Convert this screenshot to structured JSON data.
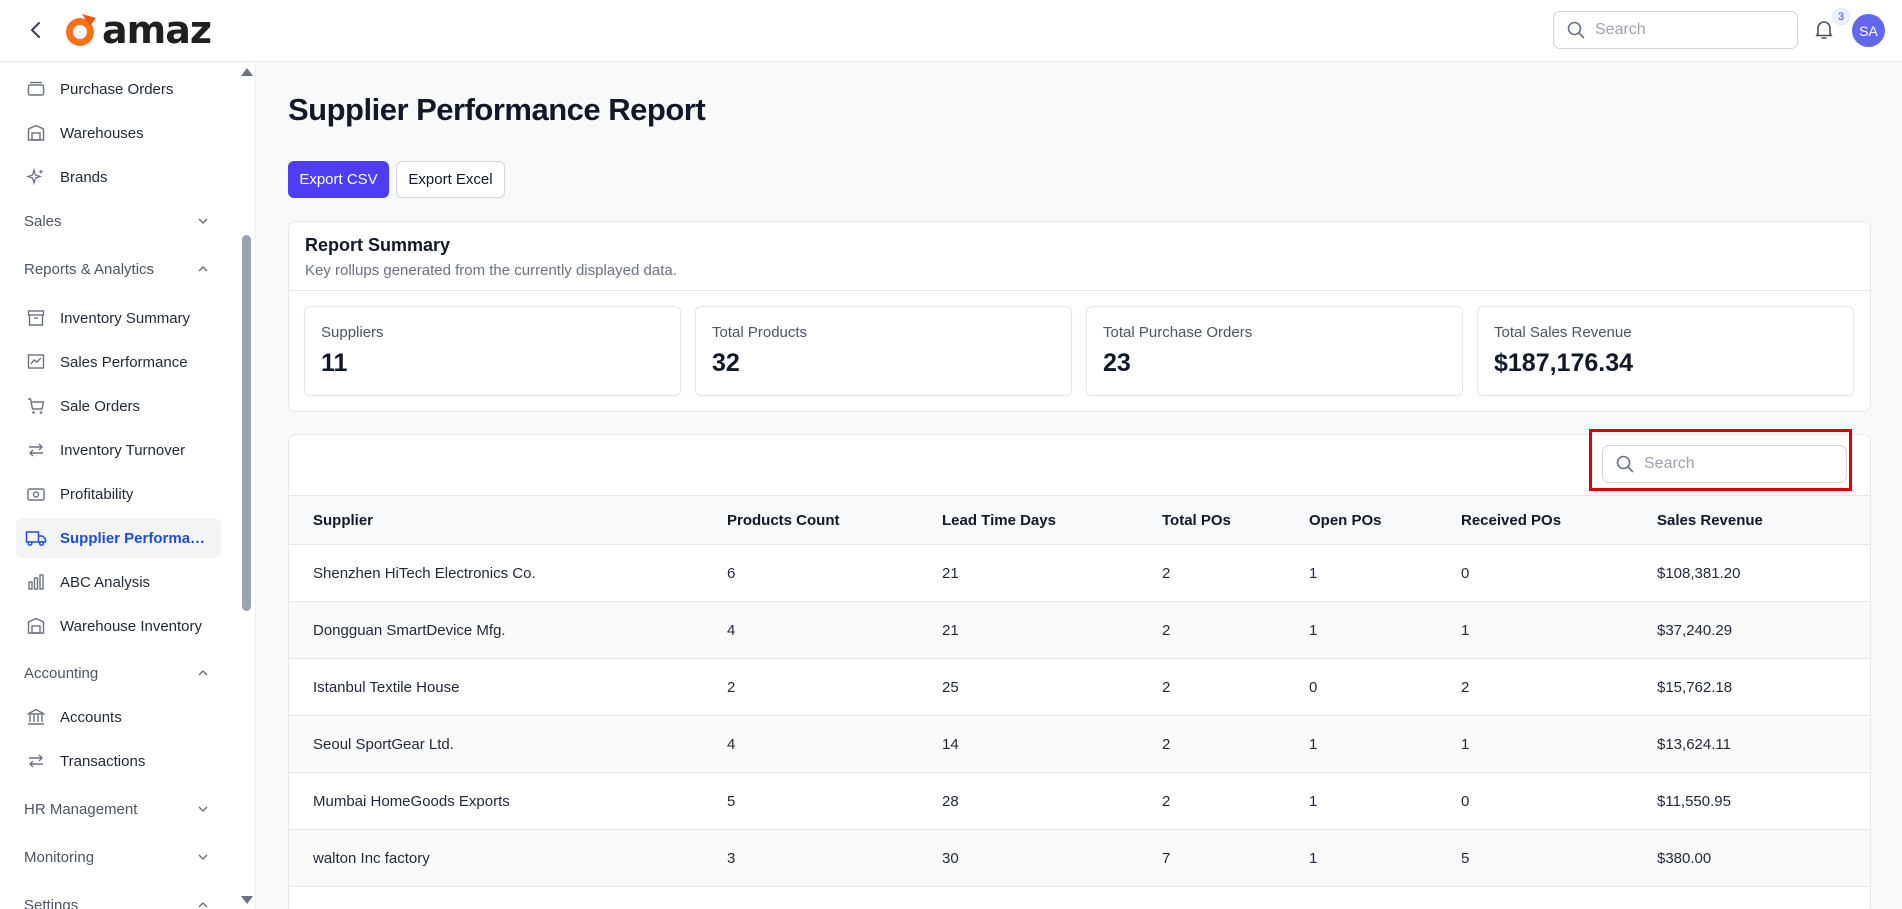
{
  "header": {
    "logo_text": "amaz",
    "search_placeholder": "Search",
    "notification_count": "3",
    "avatar_initials": "SA"
  },
  "sidebar": {
    "items": [
      {
        "label": "Purchase Orders",
        "icon": "box-icon"
      },
      {
        "label": "Warehouses",
        "icon": "warehouse-icon"
      },
      {
        "label": "Brands",
        "icon": "sparkles-icon"
      },
      {
        "label": "Inventory Summary",
        "icon": "archive-icon"
      },
      {
        "label": "Sales Performance",
        "icon": "chart-icon"
      },
      {
        "label": "Sale Orders",
        "icon": "cart-icon"
      },
      {
        "label": "Inventory Turnover",
        "icon": "arrows-icon"
      },
      {
        "label": "Profitability",
        "icon": "money-icon"
      },
      {
        "label": "Supplier Performance",
        "icon": "truck-icon"
      },
      {
        "label": "ABC Analysis",
        "icon": "bar-chart-icon"
      },
      {
        "label": "Warehouse Inventory",
        "icon": "warehouse-icon"
      },
      {
        "label": "Accounts",
        "icon": "bank-icon"
      },
      {
        "label": "Transactions",
        "icon": "arrows-icon"
      }
    ],
    "sections": [
      {
        "label": "Sales",
        "state": "collapsed"
      },
      {
        "label": "Reports & Analytics",
        "state": "expanded"
      },
      {
        "label": "Accounting",
        "state": "expanded"
      },
      {
        "label": "HR Management",
        "state": "collapsed"
      },
      {
        "label": "Monitoring",
        "state": "collapsed"
      },
      {
        "label": "Settings",
        "state": "expanded"
      }
    ]
  },
  "main": {
    "title": "Supplier Performance Report",
    "export_csv": "Export CSV",
    "export_excel": "Export Excel",
    "summary": {
      "title": "Report Summary",
      "subtitle": "Key rollups generated from the currently displayed data.",
      "stats": [
        {
          "label": "Suppliers",
          "value": "11"
        },
        {
          "label": "Total Products",
          "value": "32"
        },
        {
          "label": "Total Purchase Orders",
          "value": "23"
        },
        {
          "label": "Total Sales Revenue",
          "value": "$187,176.34"
        }
      ]
    },
    "table": {
      "search_placeholder": "Search",
      "columns": [
        "Supplier",
        "Products Count",
        "Lead Time Days",
        "Total POs",
        "Open POs",
        "Received POs",
        "Sales Revenue"
      ],
      "rows": [
        [
          "Shenzhen HiTech Electronics Co.",
          "6",
          "21",
          "2",
          "1",
          "0",
          "$108,381.20"
        ],
        [
          "Dongguan SmartDevice Mfg.",
          "4",
          "21",
          "2",
          "1",
          "1",
          "$37,240.29"
        ],
        [
          "Istanbul Textile House",
          "2",
          "25",
          "2",
          "0",
          "2",
          "$15,762.18"
        ],
        [
          "Seoul SportGear Ltd.",
          "4",
          "14",
          "2",
          "1",
          "1",
          "$13,624.11"
        ],
        [
          "Mumbai HomeGoods Exports",
          "5",
          "28",
          "2",
          "1",
          "0",
          "$11,550.95"
        ],
        [
          "walton Inc factory",
          "3",
          "30",
          "7",
          "1",
          "5",
          "$380.00"
        ]
      ]
    }
  },
  "colors": {
    "primary": "#4f3df5",
    "active_nav": "#1d4ed8",
    "highlight": "#e00000"
  }
}
